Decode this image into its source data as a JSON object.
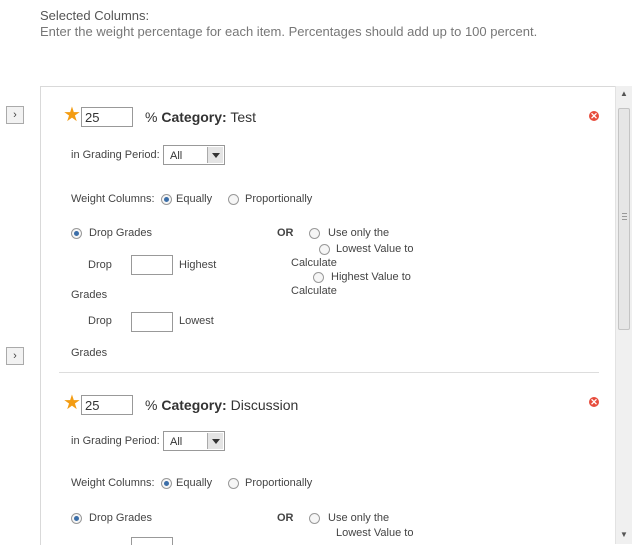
{
  "header": {
    "title": "Selected Columns:",
    "instructions": "Enter the weight percentage for each item. Percentages should add up to 100 percent."
  },
  "categories": [
    {
      "percent": "25",
      "pct_suffix": "% ",
      "category_prefix": "Category:",
      "category_name": " Test",
      "grading_period_label": "in Grading Period:",
      "grading_period_value": "All",
      "weight_columns_label": "Weight Columns:",
      "equally_label": "Equally",
      "proportionally_label": "Proportionally",
      "drop_grades_label": "Drop Grades",
      "or_label": "OR",
      "use_only_label": "Use only the",
      "lowest_value_label": "Lowest Value to",
      "calculate_label_1": "Calculate",
      "highest_value_label": "Highest Value to",
      "calculate_label_2": "Calculate",
      "drop_label_1": "Drop",
      "highest_label": "Highest",
      "grades_label_1": "Grades",
      "drop_label_2": "Drop",
      "lowest_label": "Lowest",
      "grades_label_2": "Grades",
      "weight_selected": "Equally",
      "drop_mode_selected": "Drop Grades"
    },
    {
      "percent": "25",
      "pct_suffix": "% ",
      "category_prefix": "Category:",
      "category_name": " Discussion",
      "grading_period_label": "in Grading Period:",
      "grading_period_value": "All",
      "weight_columns_label": "Weight Columns:",
      "equally_label": "Equally",
      "proportionally_label": "Proportionally",
      "drop_grades_label": "Drop Grades",
      "or_label": "OR",
      "use_only_label": "Use only the",
      "lowest_value_label": "Lowest Value to",
      "weight_selected": "Equally",
      "drop_mode_selected": "Drop Grades"
    }
  ],
  "colors": {
    "required_star": "#f39c12",
    "delete_icon": "#e74c3c",
    "radio_selected": "#3b6ea8"
  }
}
